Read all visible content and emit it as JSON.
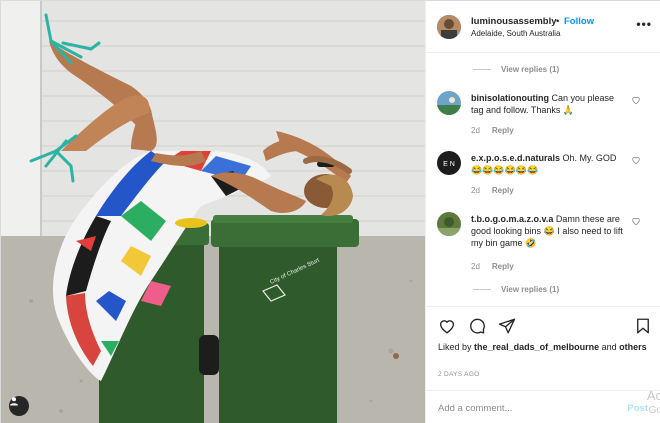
{
  "post": {
    "username": "luminousassembly",
    "separator": "•",
    "follow_label": "Follow",
    "location": "Adelaide, South Australia",
    "more_label": "•••"
  },
  "view_replies_top": "View replies (1)",
  "comments": [
    {
      "username": "binisolationouting",
      "text": "Can you please tag and follow. Thanks",
      "emoji": "🙏",
      "age": "2d",
      "reply_label": "Reply"
    },
    {
      "username": "e.x.p.o.s.e.d.naturals",
      "text": "Oh. My. GOD",
      "emoji": "😂😂😂😂😂😂",
      "age": "2d",
      "reply_label": "Reply"
    },
    {
      "username": "t.b.o.g.o.m.a.z.o.v.a",
      "text": "Damn these are good looking bins",
      "emoji_mid": "😂",
      "text2": "I also need to lift my bin game",
      "emoji": "🤣",
      "age": "2d",
      "reply_label": "Reply"
    }
  ],
  "view_replies_bottom": "View replies (1)",
  "likes": {
    "prefix": "Liked by",
    "user": "the_real_dads_of_melbourne",
    "and": "and",
    "others": "others"
  },
  "date": "2 DAYS AGO",
  "add_comment": {
    "placeholder": "Add a comment...",
    "post_label": "Post"
  },
  "watermark": {
    "line1": "Ac",
    "line2": "Go"
  },
  "bin_label": "City of Charles Sturt",
  "icons": [
    "heart-icon",
    "comment-icon",
    "share-icon",
    "bookmark-icon",
    "more-icon",
    "user-tag-icon"
  ],
  "colors": {
    "follow": "#0095f6",
    "muted": "#8e8e8e",
    "bin_green": "#2f5a2c",
    "lid_green": "#3b6e37",
    "shoe_teal": "#2bb3a3"
  }
}
